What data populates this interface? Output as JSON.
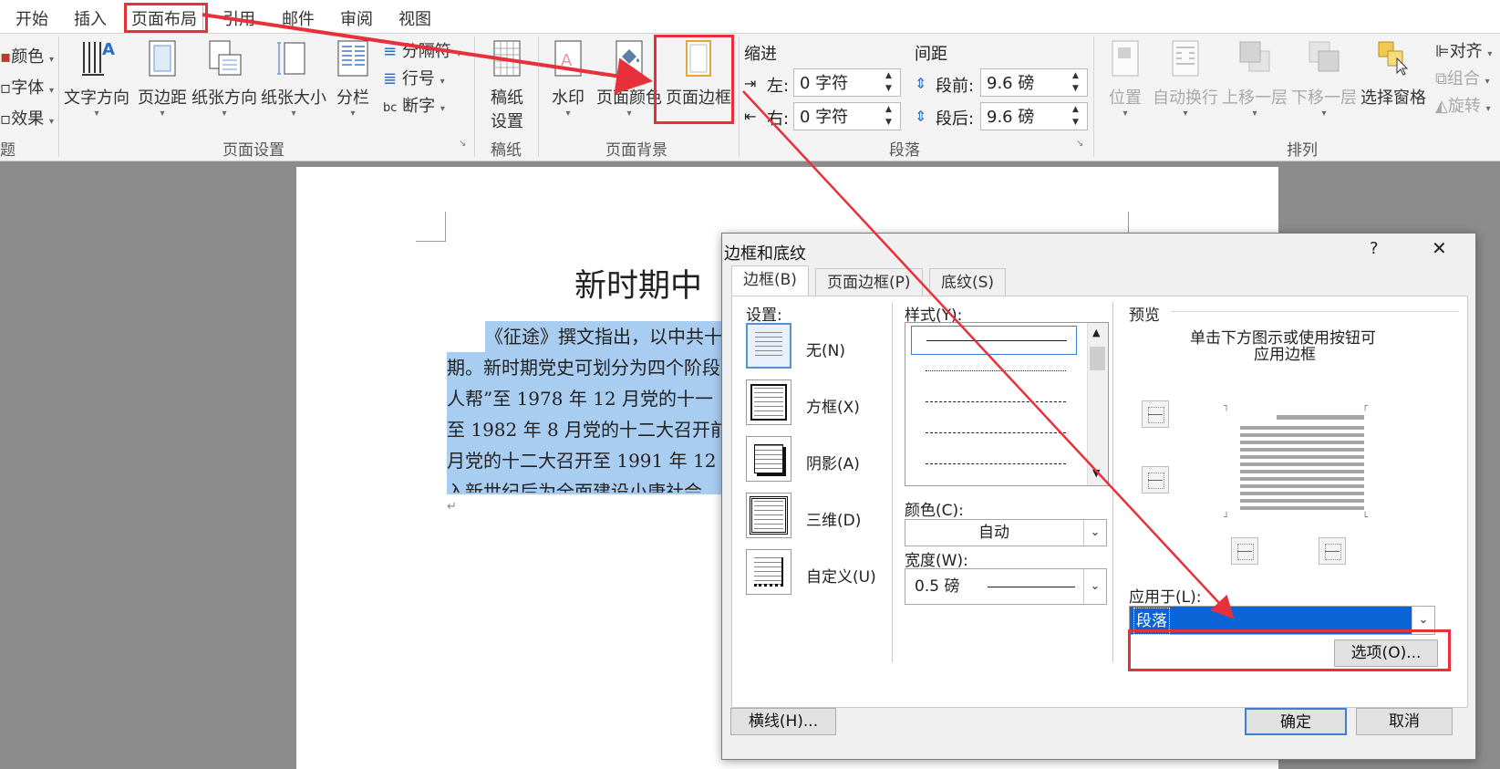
{
  "ribbon": {
    "tabs": [
      "开始",
      "插入",
      "页面布局",
      "引用",
      "邮件",
      "审阅",
      "视图"
    ],
    "active_tab": "页面布局",
    "theme_items": [
      "颜色",
      "字体",
      "效果"
    ],
    "theme_group_label": "题",
    "page_setup": {
      "buttons": [
        "文字方向",
        "页边距",
        "纸张方向",
        "纸张大小",
        "分栏"
      ],
      "small_items": [
        "分隔符",
        "行号",
        "断字"
      ],
      "label": "页面设置"
    },
    "manuscript": {
      "button_line1": "稿纸",
      "button_line2": "设置",
      "label": "稿纸"
    },
    "page_background": {
      "buttons": [
        "水印",
        "页面颜色",
        "页面边框"
      ],
      "label": "页面背景"
    },
    "paragraph": {
      "indent_title": "缩进",
      "spacing_title": "间距",
      "indent_left_label": "左:",
      "indent_left_value": "0 字符",
      "indent_right_label": "右:",
      "indent_right_value": "0 字符",
      "space_before_label": "段前:",
      "space_before_value": "9.6 磅",
      "space_after_label": "段后:",
      "space_after_value": "9.6 磅",
      "label": "段落"
    },
    "arrange": {
      "buttons": [
        "位置",
        "自动换行",
        "上移一层",
        "下移一层",
        "选择窗格"
      ],
      "small_items": [
        "对齐",
        "组合",
        "旋转"
      ],
      "label": "排列"
    }
  },
  "document": {
    "title": "新时期中",
    "lines": [
      "《征途》撰文指出，以中共十",
      "期。新时期党史可划分为四个阶段",
      "人帮”至 1978 年 12 月党的十一",
      "至 1982 年 8 月党的十二大召开前",
      "月党的十二大召开至 1991 年 12",
      "入新世纪后为全面建设小康社会"
    ],
    "paragraph_mark": "↵"
  },
  "dialog": {
    "title": "边框和底纹",
    "help": "?",
    "close": "✕",
    "tabs": [
      "边框(B)",
      "页面边框(P)",
      "底纹(S)"
    ],
    "settings_label": "设置:",
    "settings": [
      "无(N)",
      "方框(X)",
      "阴影(A)",
      "三维(D)",
      "自定义(U)"
    ],
    "style_label": "样式(Y):",
    "color_label": "颜色(C):",
    "color_value": "自动",
    "width_label": "宽度(W):",
    "width_value": "0.5 磅",
    "preview_label": "预览",
    "preview_hint_1": "单击下方图示或使用按钮可",
    "preview_hint_2": "应用边框",
    "apply_label": "应用于(L):",
    "apply_value": "段落",
    "options_button": "选项(O)...",
    "hline_button": "横线(H)...",
    "ok_button": "确定",
    "cancel_button": "取消"
  },
  "colors": {
    "highlight": "#e8303a",
    "selection": "#a9cdf0",
    "accent": "#0a64d6"
  }
}
